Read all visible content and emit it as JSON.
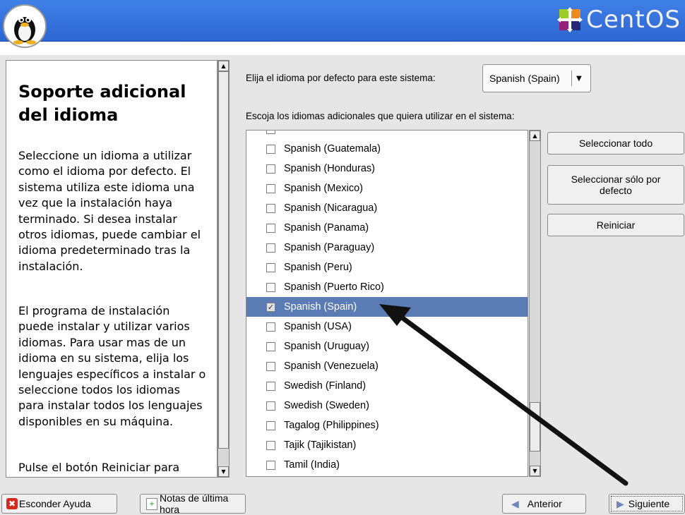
{
  "brand": {
    "name": "CentOS"
  },
  "help": {
    "title": "Soporte adicional del idioma",
    "paragraph1": "Seleccione un idioma a utilizar como el idioma por defecto. El sistema utiliza este idioma una vez que la instalación haya terminado. Si desea instalar otros idiomas, puede cambiar el idioma predeterminado tras la instalación.",
    "paragraph2": "El programa de instalación puede instalar y utilizar varios idiomas. Para usar mas de un idioma en su sistema, elija los lenguajes específicos a instalar o seleccione todos los idiomas para instalar todos los lenguajes disponibles en su máquina.",
    "paragraph3": "Pulse el botón Reiniciar para"
  },
  "default_language": {
    "label": "Elija el idioma por defecto para este sistema:",
    "selected": "Spanish (Spain)"
  },
  "additional": {
    "label": "Escoja los idiomas adicionales que quiera utilizar en el sistema:",
    "items": [
      {
        "label": "Spanish (Guatemala)",
        "checked": false
      },
      {
        "label": "Spanish (Honduras)",
        "checked": false
      },
      {
        "label": "Spanish (Mexico)",
        "checked": false
      },
      {
        "label": "Spanish (Nicaragua)",
        "checked": false
      },
      {
        "label": "Spanish (Panama)",
        "checked": false
      },
      {
        "label": "Spanish (Paraguay)",
        "checked": false
      },
      {
        "label": "Spanish (Peru)",
        "checked": false
      },
      {
        "label": "Spanish (Puerto Rico)",
        "checked": false
      },
      {
        "label": "Spanish (Spain)",
        "checked": true
      },
      {
        "label": "Spanish (USA)",
        "checked": false
      },
      {
        "label": "Spanish (Uruguay)",
        "checked": false
      },
      {
        "label": "Spanish (Venezuela)",
        "checked": false
      },
      {
        "label": "Swedish (Finland)",
        "checked": false
      },
      {
        "label": "Swedish (Sweden)",
        "checked": false
      },
      {
        "label": "Tagalog (Philippines)",
        "checked": false
      },
      {
        "label": "Tajik (Tajikistan)",
        "checked": false
      },
      {
        "label": "Tamil (India)",
        "checked": false
      }
    ]
  },
  "buttons": {
    "select_all": "Seleccionar todo",
    "select_default_only": "Seleccionar sólo por defecto",
    "reset": "Reiniciar",
    "hide_help": "Esconder Ayuda",
    "release_notes": "Notas de última hora",
    "back": "Anterior",
    "next": "Siguiente"
  },
  "colors": {
    "banner": "#3a78e0",
    "selection": "#5b7bb5",
    "arrow": "#111111"
  }
}
